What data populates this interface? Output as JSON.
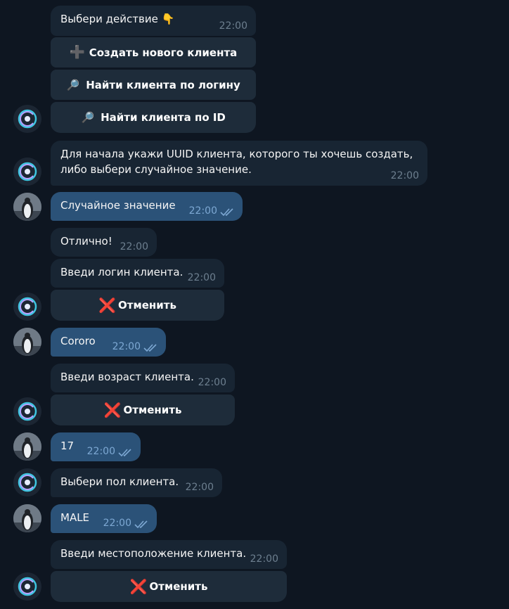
{
  "messages": [
    {
      "text": "Выбери действие 👇",
      "time": "22:00"
    },
    {
      "text": "Для начала укажи UUID клиента, которого ты хочешь создать,\nлибо выбери случайное значение.",
      "time": "22:00"
    },
    {
      "text": "Случайное значение",
      "time": "22:00"
    },
    {
      "text": "Отлично!",
      "time": "22:00"
    },
    {
      "text": "Введи логин клиента.",
      "time": "22:00"
    },
    {
      "text": "Cororo",
      "time": "22:00"
    },
    {
      "text": "Введи возраст клиента.",
      "time": "22:00"
    },
    {
      "text": "17",
      "time": "22:00"
    },
    {
      "text": "Выбери пол клиента.",
      "time": "22:00"
    },
    {
      "text": "MALE",
      "time": "22:00"
    },
    {
      "text": "Введи местоположение клиента.",
      "time": "22:00"
    }
  ],
  "buttons": {
    "create_client": "Создать нового клиента",
    "find_by_login": "Найти клиента по логину",
    "find_by_id": "Найти клиента по ID",
    "cancel": "Отменить"
  },
  "glyphs": {
    "plus": "➕",
    "search": "🔎",
    "cross": "❌"
  },
  "colors": {
    "background": "#0e1621",
    "incoming": "#182533",
    "outgoing": "#2b5278",
    "keyboard_button": "#1e2c3a",
    "cancel_icon": "#e0262b"
  }
}
